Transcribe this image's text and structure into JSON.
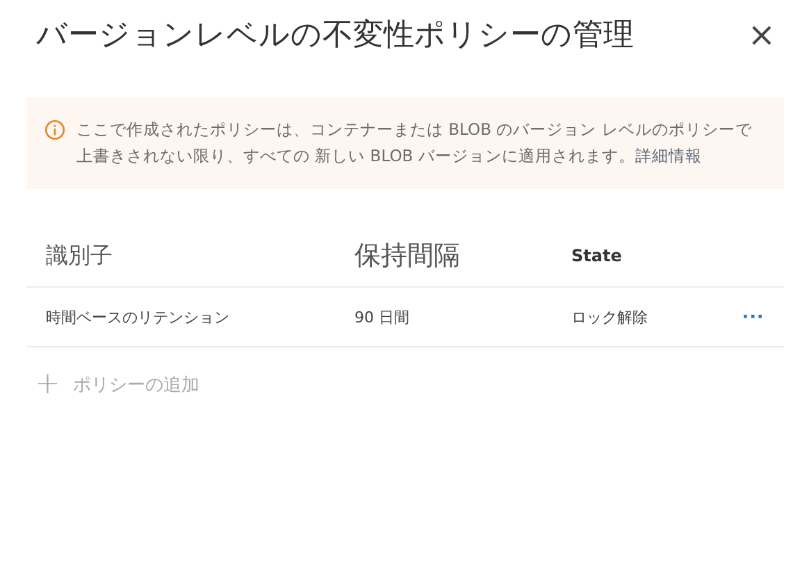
{
  "dialog": {
    "title": "バージョンレベルの不変性ポリシーの管理",
    "close": "×"
  },
  "banner": {
    "message": "ここで作成されたポリシーは、コンテナーまたは BLOB のバージョン レベルのポリシーで上書きされない限り、すべての 新しい BLOB バージョンに適用されます。",
    "link": "詳細情報"
  },
  "table": {
    "columns": [
      "識別子",
      "保持間隔",
      "State"
    ],
    "rows": [
      {
        "cells": [
          "時間ベースのリテンション",
          "90 日間",
          "ロック解除"
        ],
        "menu": "···"
      }
    ]
  },
  "add_button": {
    "label": "ポリシーの追加",
    "icon": "+",
    "disabled": true
  }
}
